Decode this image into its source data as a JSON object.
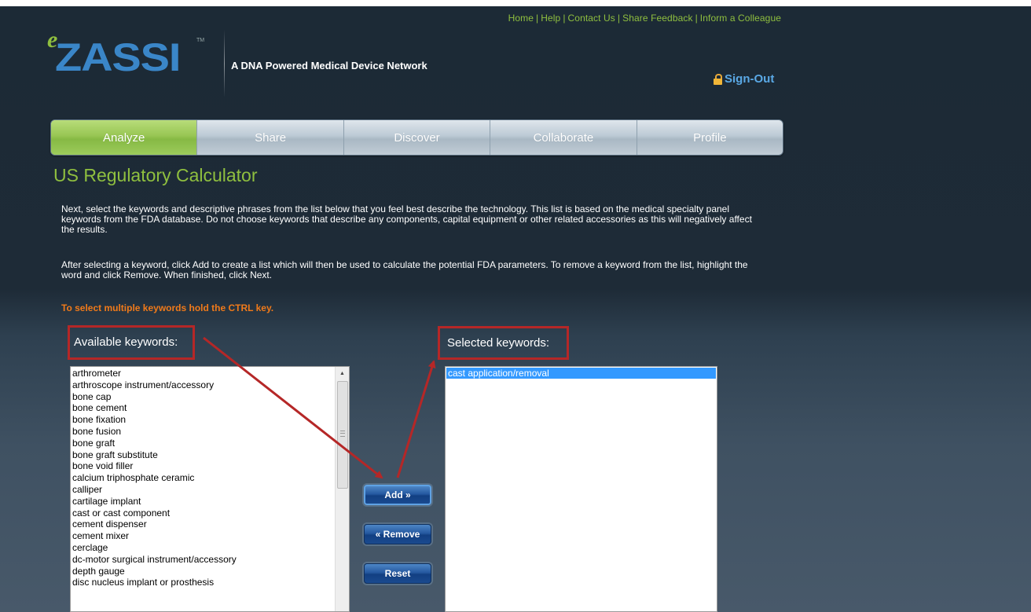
{
  "header": {
    "top_links": [
      "Home",
      "Help",
      "Contact Us",
      "Share Feedback",
      "Inform a Colleague"
    ],
    "logo": {
      "prefix": "e",
      "name": "ZASSI",
      "trademark": "TM"
    },
    "tagline": "A DNA Powered Medical Device Network",
    "sign_out_label": "Sign-Out"
  },
  "nav": {
    "tabs": [
      {
        "label": "Analyze",
        "active": true
      },
      {
        "label": "Share",
        "active": false
      },
      {
        "label": "Discover",
        "active": false
      },
      {
        "label": "Collaborate",
        "active": false
      },
      {
        "label": "Profile",
        "active": false
      }
    ]
  },
  "main": {
    "title": "US Regulatory Calculator",
    "paragraph1": "Next, select the keywords and descriptive phrases from the list below that you feel best describe the technology. This list is based on the medical specialty panel keywords from the FDA database. Do not choose keywords that describe any components, capital equipment or other related accessories as this will negatively affect the results.",
    "paragraph2": "After selecting a keyword, click Add to create a list which will then be used to calculate the potential FDA parameters. To remove a keyword from the list, highlight the word and click Remove. When finished, click Next.",
    "ctrl_hint": "To select multiple keywords hold the CTRL key.",
    "available_label": "Available keywords:",
    "selected_label": "Selected keywords:",
    "available_keywords": [
      "arthrometer",
      "arthroscope instrument/accessory",
      "bone cap",
      "bone cement",
      "bone fixation",
      "bone fusion",
      "bone graft",
      "bone graft substitute",
      "bone void filler",
      "calcium triphosphate ceramic",
      "calliper",
      "cartilage implant",
      "cast or cast component",
      "cement dispenser",
      "cement mixer",
      "cerclage",
      "dc-motor surgical instrument/accessory",
      "depth gauge",
      "disc nucleus implant or prosthesis"
    ],
    "selected_keywords": [
      "cast application/removal"
    ],
    "buttons": {
      "add": "Add »",
      "remove": "« Remove",
      "reset": "Reset"
    }
  },
  "colors": {
    "accent_green": "#8fbf3f",
    "link_blue": "#5aa9e6",
    "annotation_red": "#b52727",
    "hint_orange": "#f07a1a",
    "selection_blue": "#3399ff"
  }
}
